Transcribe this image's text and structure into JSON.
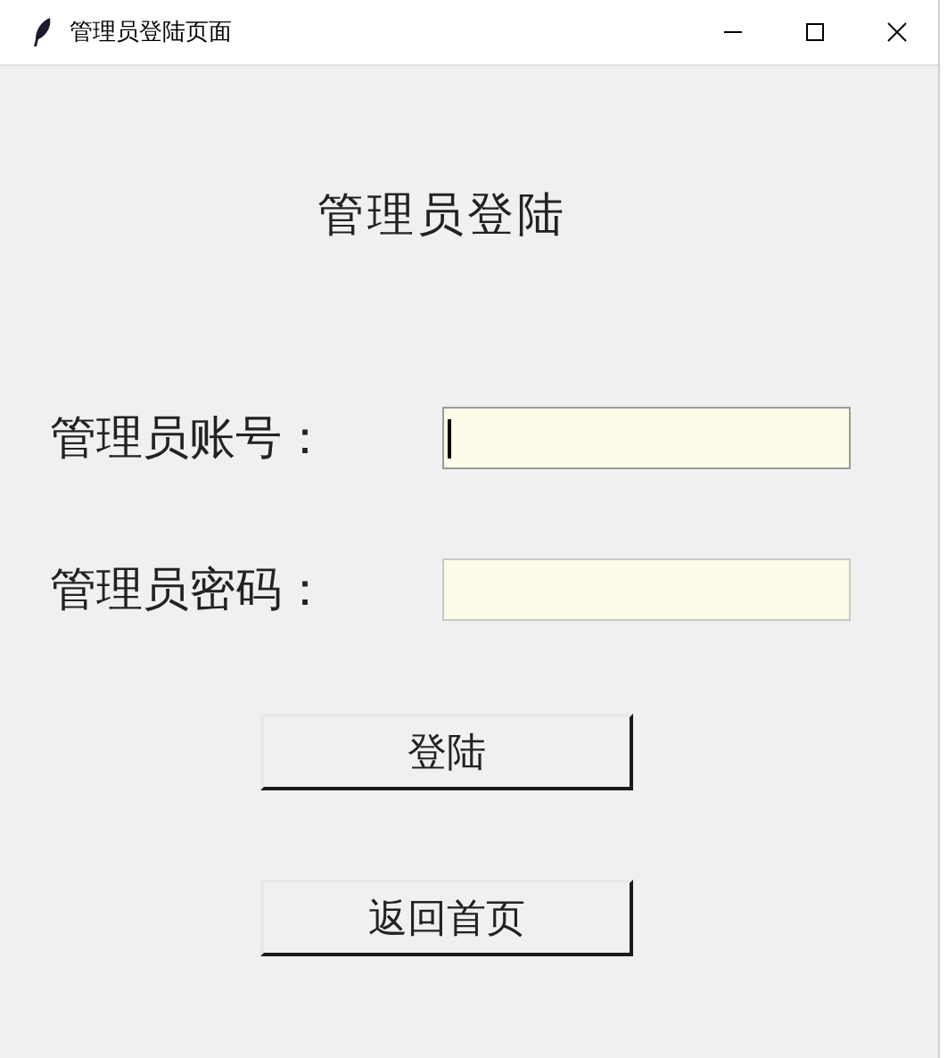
{
  "window": {
    "title": "管理员登陆页面"
  },
  "heading": "管理员登陆",
  "fields": [
    {
      "label": "管理员账号：",
      "focused": true
    },
    {
      "label": "管理员密码：",
      "focused": false
    }
  ],
  "buttons": [
    "登陆",
    "返回首页"
  ]
}
